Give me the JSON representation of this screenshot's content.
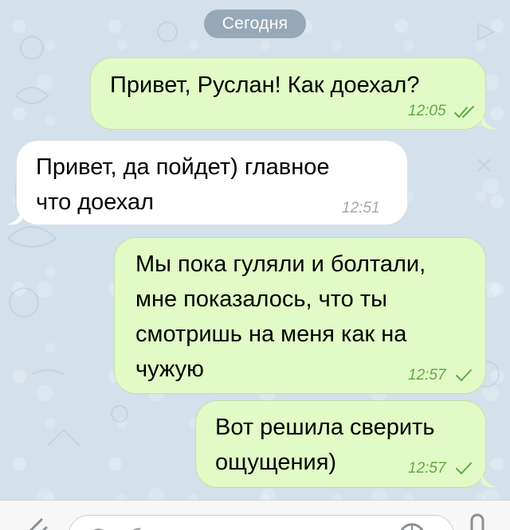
{
  "chat": {
    "date_label": "Сегодня",
    "messages": [
      {
        "direction": "out",
        "text": "Привет, Руслан! Как доехал?",
        "time": "12:05",
        "status": "read"
      },
      {
        "direction": "in",
        "text": "Привет, да пойдет) главное\nчто доехал",
        "time": "12:51"
      },
      {
        "direction": "out",
        "text": "Мы пока гуляли и болтали,\nмне показалось, что ты\nсмотришь на меня как на\nчужую",
        "time": "12:57",
        "status": "sent"
      },
      {
        "direction": "out",
        "text": "Вот решила сверить\nощущения)",
        "time": "12:57",
        "status": "sent"
      }
    ]
  },
  "input": {
    "placeholder": "Сообщение"
  },
  "icons": {
    "attach": "paperclip-icon",
    "sticker": "sticker-icon",
    "voice": "microphone-icon",
    "read_status": "double-check-icon",
    "sent_status": "check-icon"
  },
  "colors": {
    "outgoing_bubble": "#e2fac6",
    "incoming_bubble": "#ffffff",
    "outgoing_time": "#5eab44",
    "date_pill": "#97a8b6",
    "chat_background": "#d4e0ea"
  }
}
